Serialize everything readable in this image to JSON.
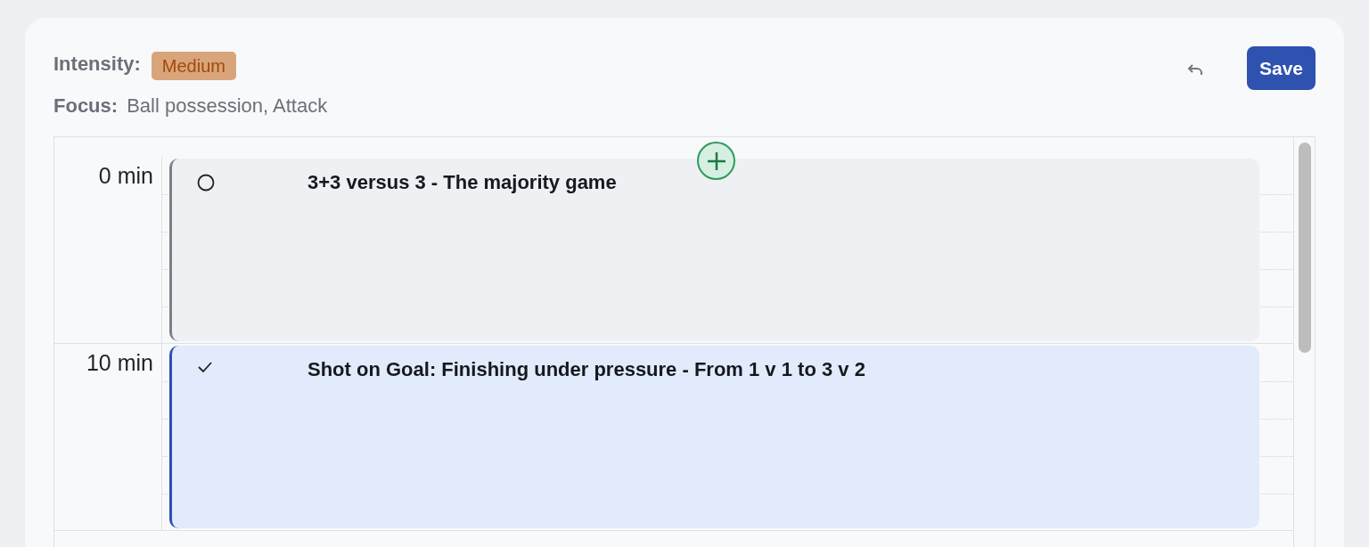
{
  "header": {
    "intensity_label": "Intensity:",
    "intensity": "Medium",
    "focus_label": "Focus:",
    "focus": "Ball possession, Attack",
    "save": "Save"
  },
  "slots": [
    {
      "time": "0 min",
      "event": {
        "title": "3+3 versus 3 - The majority game",
        "done": false,
        "color": "#7b7f88"
      }
    },
    {
      "time": "10 min",
      "event": {
        "title": "Shot on Goal: Finishing under pressure - From 1 v 1 to 3 v 2",
        "done": true,
        "color": "#2f4fb0"
      }
    }
  ]
}
